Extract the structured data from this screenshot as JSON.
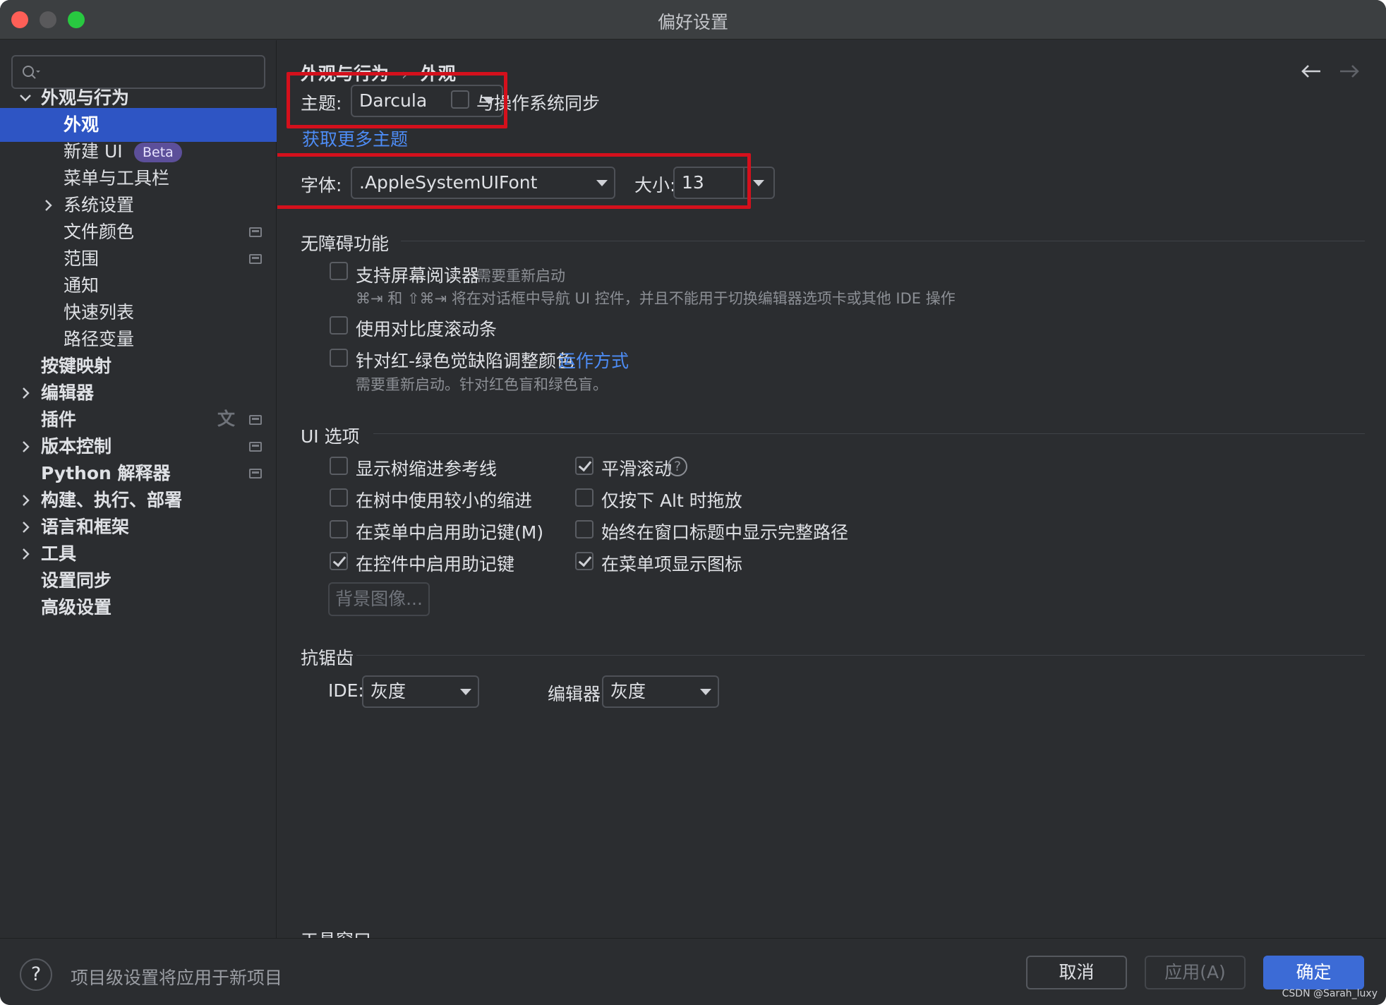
{
  "window": {
    "title": "偏好设置"
  },
  "sidebar": {
    "search_placeholder": "",
    "items": [
      {
        "label": "外观与行为"
      },
      {
        "label": "外观"
      },
      {
        "label": "新建 UI",
        "badge": "Beta"
      },
      {
        "label": "菜单与工具栏"
      },
      {
        "label": "系统设置"
      },
      {
        "label": "文件颜色"
      },
      {
        "label": "范围"
      },
      {
        "label": "通知"
      },
      {
        "label": "快速列表"
      },
      {
        "label": "路径变量"
      },
      {
        "label": "按键映射"
      },
      {
        "label": "编辑器"
      },
      {
        "label": "插件"
      },
      {
        "label": "版本控制"
      },
      {
        "label": "Python 解释器"
      },
      {
        "label": "构建、执行、部署"
      },
      {
        "label": "语言和框架"
      },
      {
        "label": "工具"
      },
      {
        "label": "设置同步"
      },
      {
        "label": "高级设置"
      }
    ]
  },
  "breadcrumb": {
    "parent": "外观与行为",
    "separator": "›",
    "current": "外观"
  },
  "theme": {
    "label": "主题:",
    "value": "Darcula",
    "sync_label": "与操作系统同步",
    "sync_checked": false,
    "more_link": "获取更多主题"
  },
  "font": {
    "label": "字体:",
    "value": ".AppleSystemUIFont",
    "size_label": "大小:",
    "size_value": "13"
  },
  "accessibility": {
    "title": "无障碍功能",
    "screen_reader": {
      "label": "支持屏幕阅读器",
      "note": "需要重新启动",
      "checked": false
    },
    "screen_reader_hint": "⌘⇥ 和 ⇧⌘⇥ 将在对话框中导航 UI 控件，并且不能用于切换编辑器选项卡或其他 IDE 操作",
    "contrast_scrollbars": {
      "label": "使用对比度滚动条",
      "checked": false
    },
    "color_deficiency": {
      "label": "针对红-绿色觉缺陷调整颜色",
      "link": "运作方式",
      "checked": false
    },
    "color_deficiency_hint": "需要重新启动。针对红色盲和绿色盲。"
  },
  "ui_options": {
    "title": "UI 选项",
    "left": [
      {
        "label": "显示树缩进参考线",
        "checked": false
      },
      {
        "label": "在树中使用较小的缩进",
        "checked": false
      },
      {
        "label": "在菜单中启用助记键(M)",
        "checked": false
      },
      {
        "label": "在控件中启用助记键",
        "checked": true
      }
    ],
    "right": [
      {
        "label": "平滑滚动",
        "checked": true,
        "help": "?"
      },
      {
        "label": "仅按下 Alt 时拖放",
        "checked": false
      },
      {
        "label": "始终在窗口标题中显示完整路径",
        "checked": false
      },
      {
        "label": "在菜单项显示图标",
        "checked": true
      }
    ],
    "background_button": "背景图像..."
  },
  "antialiasing": {
    "title": "抗锯齿",
    "ide_label": "IDE:",
    "ide_value": "灰度",
    "editor_label": "编辑器:",
    "editor_value": "灰度"
  },
  "tool_windows": {
    "title": "工具窗口"
  },
  "footer": {
    "help": "?",
    "note": "项目级设置将应用于新项目",
    "cancel": "取消",
    "apply": "应用(A)",
    "ok": "确定",
    "watermark": "CSDN @Sarah_luxy"
  },
  "colors": {
    "background": "#2b2d30",
    "selection": "#2e55c4",
    "link": "#4d8cf5",
    "highlight_frame": "#d4101c",
    "primary_button": "#3c6bd6",
    "beta_badge": "#5c4f9a"
  }
}
